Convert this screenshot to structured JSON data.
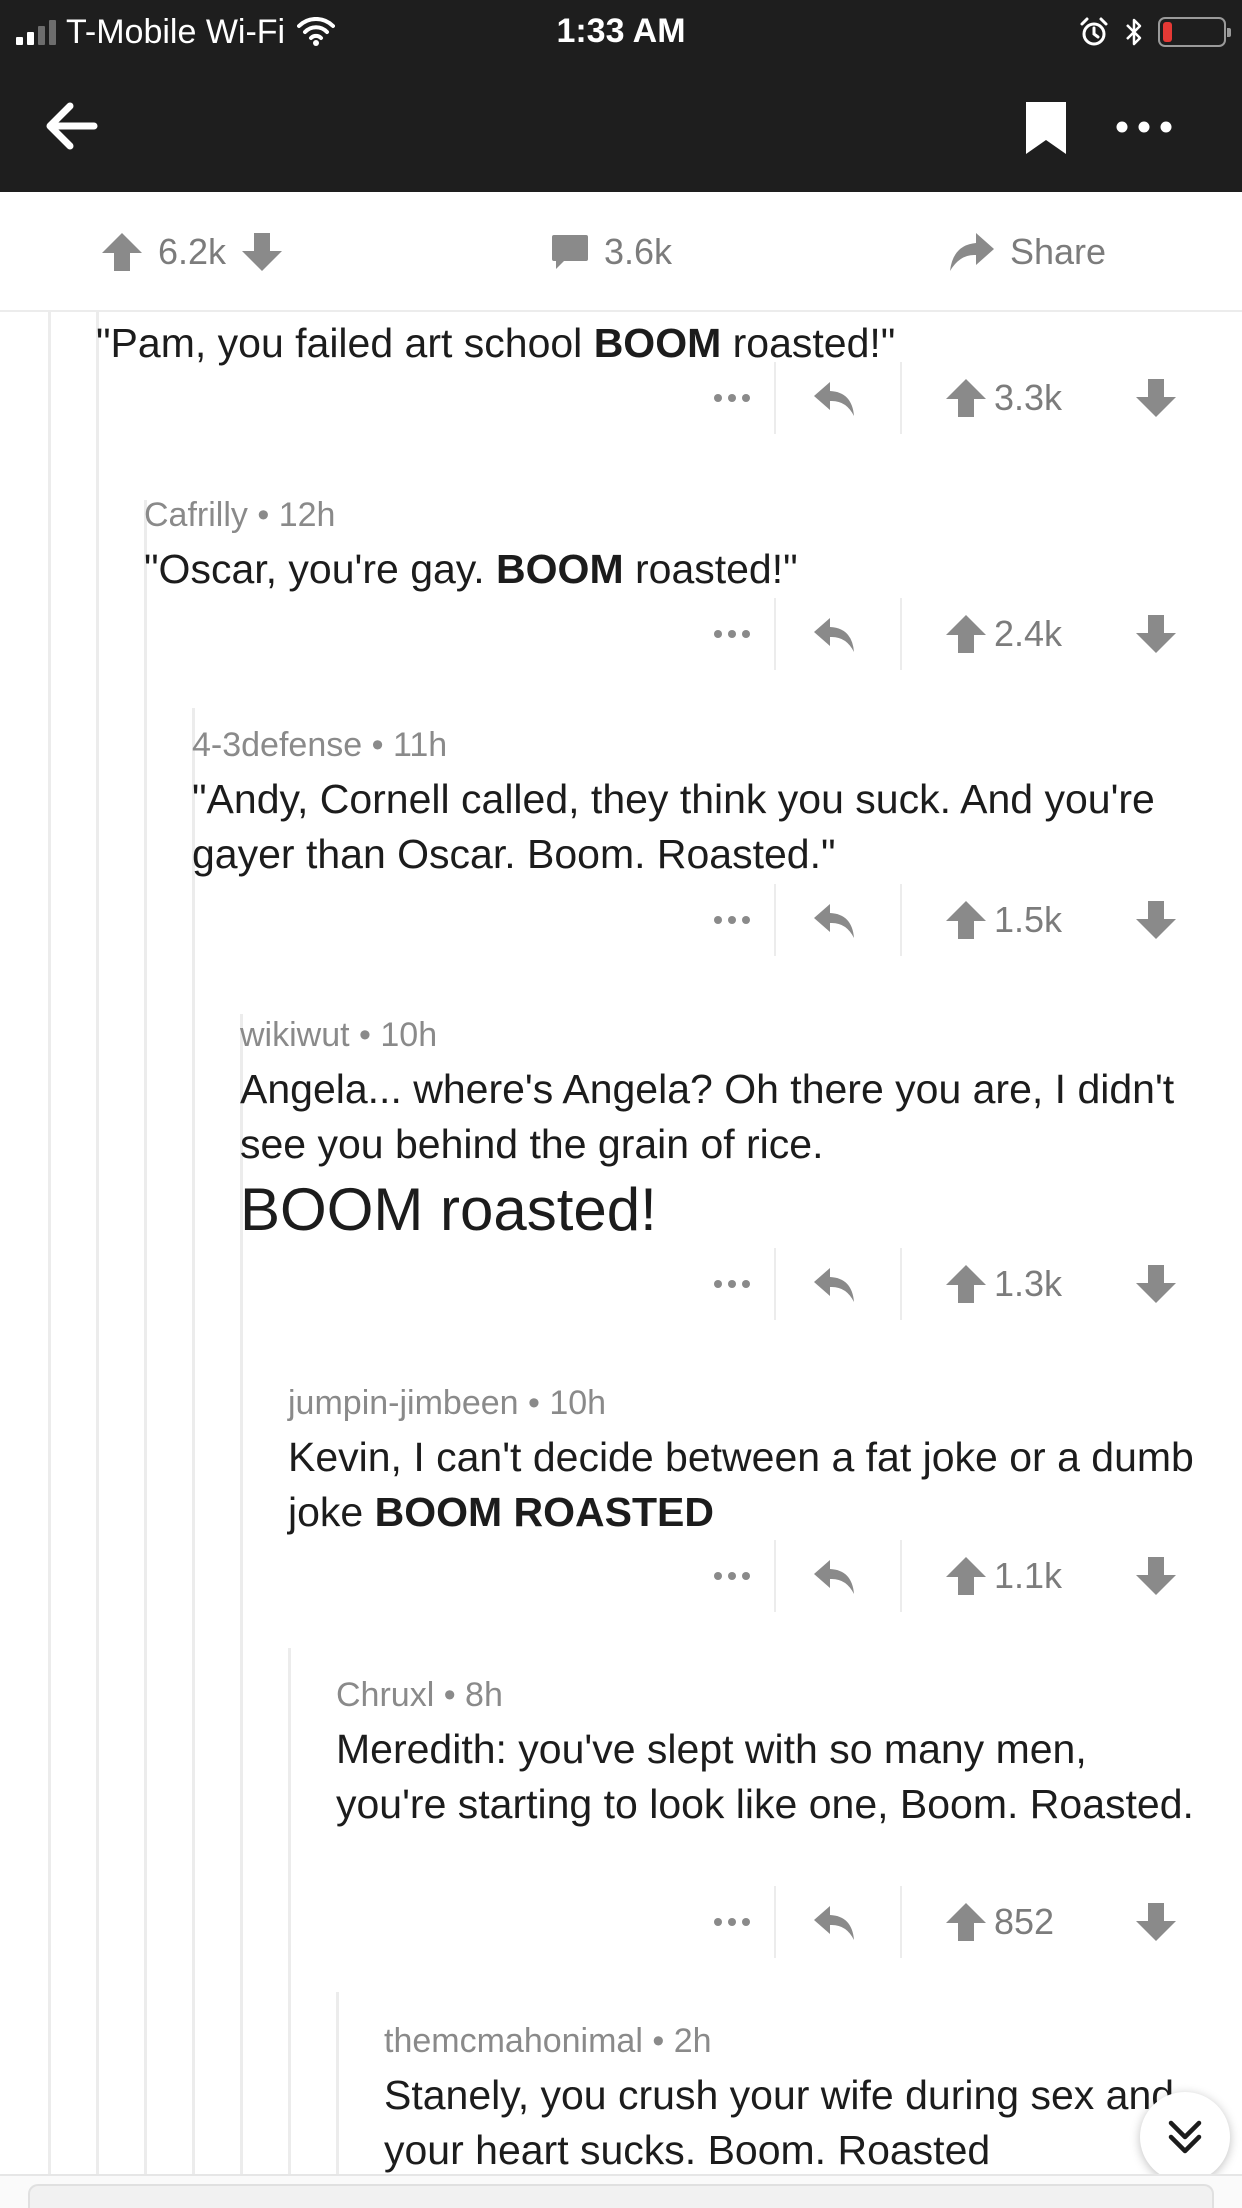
{
  "status_bar": {
    "carrier": "T-Mobile Wi-Fi",
    "time": "1:33 AM",
    "battery_level": 0.15,
    "battery_color": "#e53935"
  },
  "nav": {
    "back_icon": "arrow-left-icon",
    "bookmark_icon": "bookmark-icon",
    "more_icon": "more-icon"
  },
  "post_bar": {
    "score": "6.2k",
    "comments": "3.6k",
    "share_label": "Share"
  },
  "comments": [
    {
      "author": "",
      "age": "",
      "body_before": "\"Pam, you failed art school ",
      "body_bold": "BOOM",
      "body_after": " roasted!\"",
      "score": "3.3k",
      "depth": 0
    },
    {
      "author": "Cafrilly",
      "age": "12h",
      "body_before": "\"Oscar, you're gay. ",
      "body_bold": "BOOM",
      "body_after": " roasted!\"",
      "score": "2.4k",
      "depth": 1
    },
    {
      "author": "4-3defense",
      "age": "11h",
      "body": "\"Andy, Cornell called, they think you suck. And you're gayer than Oscar. Boom. Roasted.\"",
      "score": "1.5k",
      "depth": 2
    },
    {
      "author": "wikiwut",
      "age": "10h",
      "body": "Angela... where's Angela? Oh there you are, I didn't see you behind the grain of rice.",
      "body_big": "BOOM roasted!",
      "score": "1.3k",
      "depth": 3
    },
    {
      "author": "jumpin-jimbeen",
      "age": "10h",
      "body_before": "Kevin, I can't decide between a fat joke or a dumb joke ",
      "body_bold": "BOOM ROASTED",
      "score": "1.1k",
      "depth": 4
    },
    {
      "author": "Chruxl",
      "age": "8h",
      "body": "Meredith: you've slept with so many men, you're starting to look like one, Boom. Roasted.",
      "score": "852",
      "depth": 5
    },
    {
      "author": "themcmahonimal",
      "age": "2h",
      "body": "Stanely, you crush your wife during sex and your heart sucks. Boom. Roasted",
      "depth": 6
    }
  ]
}
